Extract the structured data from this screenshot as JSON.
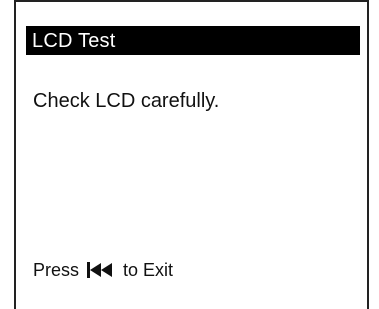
{
  "screen": {
    "title": "LCD Test",
    "message": "Check LCD carefully.",
    "footer": {
      "press_label": "Press",
      "icon": "skip-back-icon",
      "exit_label": "to Exit"
    }
  },
  "colors": {
    "title_bar_background": "#000000",
    "title_text": "#ffffff",
    "body_text": "#111111",
    "screen_background": "#ffffff"
  }
}
